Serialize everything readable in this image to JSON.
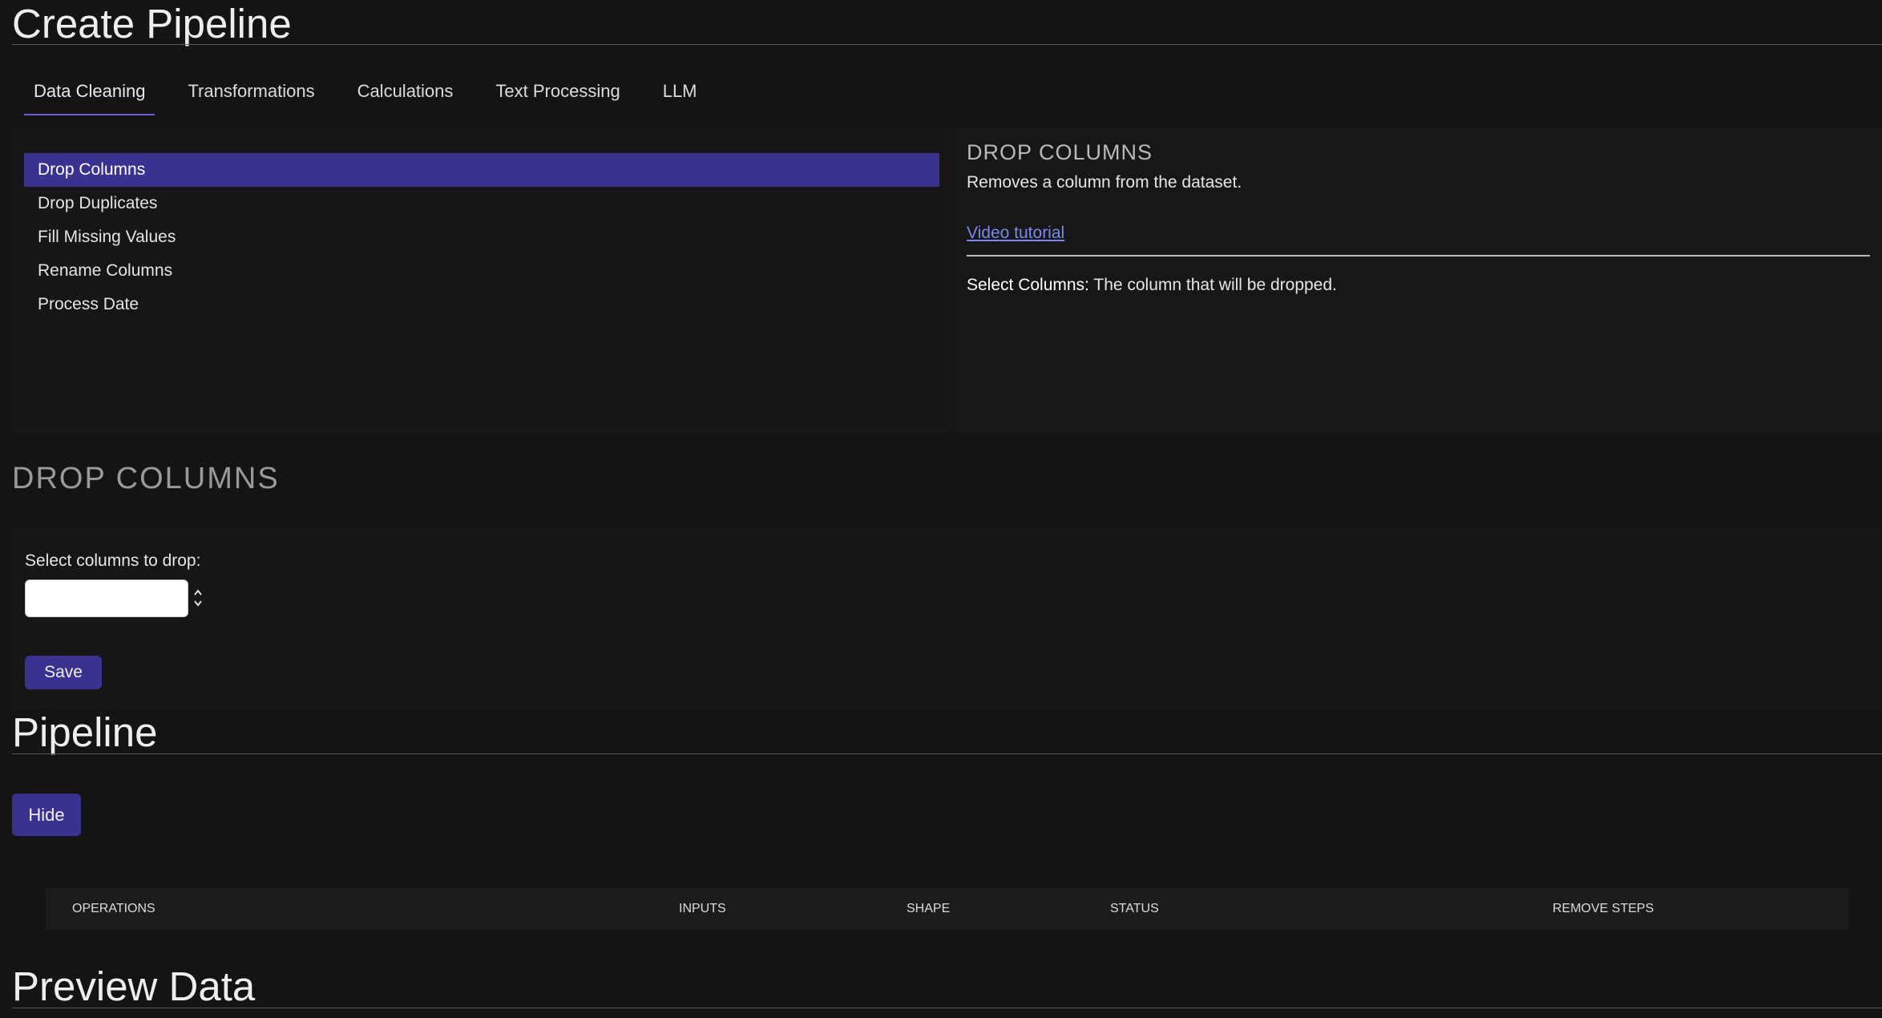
{
  "page": {
    "title": "Create Pipeline"
  },
  "tabs": [
    {
      "label": "Data Cleaning",
      "active": true
    },
    {
      "label": "Transformations",
      "active": false
    },
    {
      "label": "Calculations",
      "active": false
    },
    {
      "label": "Text Processing",
      "active": false
    },
    {
      "label": "LLM",
      "active": false
    }
  ],
  "operations": [
    {
      "label": "Drop Columns",
      "selected": true
    },
    {
      "label": "Drop Duplicates",
      "selected": false
    },
    {
      "label": "Fill Missing Values",
      "selected": false
    },
    {
      "label": "Rename Columns",
      "selected": false
    },
    {
      "label": "Process Date",
      "selected": false
    }
  ],
  "description": {
    "title": "DROP COLUMNS",
    "text": "Removes a column from the dataset.",
    "link": "Video tutorial",
    "param_name": "Select Columns:",
    "param_desc": " The column that will be dropped."
  },
  "config": {
    "title": "DROP COLUMNS",
    "select_label": "Select columns to drop:",
    "save_label": "Save"
  },
  "pipeline": {
    "title": "Pipeline",
    "hide_label": "Hide",
    "columns": [
      "OPERATIONS",
      "INPUTS",
      "SHAPE",
      "STATUS",
      "REMOVE STEPS"
    ]
  },
  "preview": {
    "title": "Preview Data"
  },
  "colors": {
    "background": "#141414",
    "accent": "#3a3290",
    "tab_underline": "#6a5fd6",
    "link": "#7b88f0"
  }
}
